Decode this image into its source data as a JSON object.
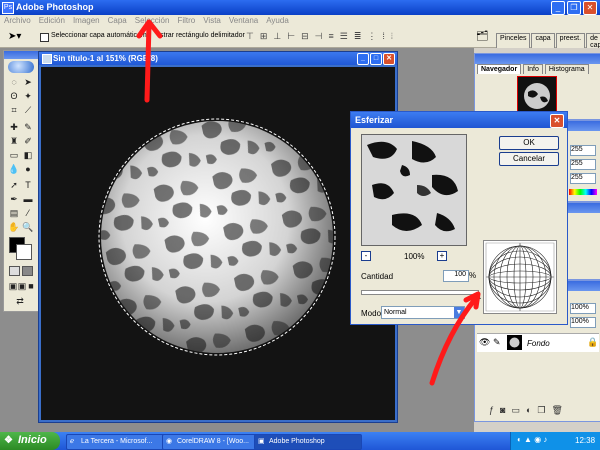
{
  "app": {
    "title": "Adobe Photoshop",
    "menu": [
      "Archivo",
      "Edición",
      "Imagen",
      "Capa",
      "Selección",
      "Filtro",
      "Vista",
      "Ventana",
      "Ayuda"
    ]
  },
  "options": {
    "autoselect_label": "Seleccionar capa automáticame",
    "bounding_label": "strar rectángulo delimitador",
    "tabs": [
      "Pinceles",
      "capa",
      "preest.",
      "de capas"
    ]
  },
  "document": {
    "title": "Sin título-1 al 151% (RGB/8)"
  },
  "navigator": {
    "tabs": [
      "Navegador",
      "Info",
      "Histograma"
    ]
  },
  "color_values": [
    "255",
    "255",
    "255"
  ],
  "layers": {
    "opacity": "100%",
    "fill": "100%",
    "layer_name": "Fondo"
  },
  "dialog": {
    "title": "Esferizar",
    "ok": "OK",
    "cancel": "Cancelar",
    "zoom": "100%",
    "zoom_minus": "-",
    "zoom_plus": "+",
    "amount_label": "Cantidad",
    "amount_value": "100",
    "amount_unit": "%",
    "amount_slider": 1.0,
    "mode_label": "Modo",
    "mode_value": "Normal"
  },
  "taskbar": {
    "start": "Inicio",
    "tasks": [
      "La Tercera - Microsof...",
      "CorelDRAW 8 - [Woo...",
      "Adobe Photoshop"
    ],
    "clock": "12:38"
  },
  "colors": {
    "arrow": "#ff1a1a",
    "xp_blue": "#2058d6",
    "start_green": "#2c8a24"
  }
}
